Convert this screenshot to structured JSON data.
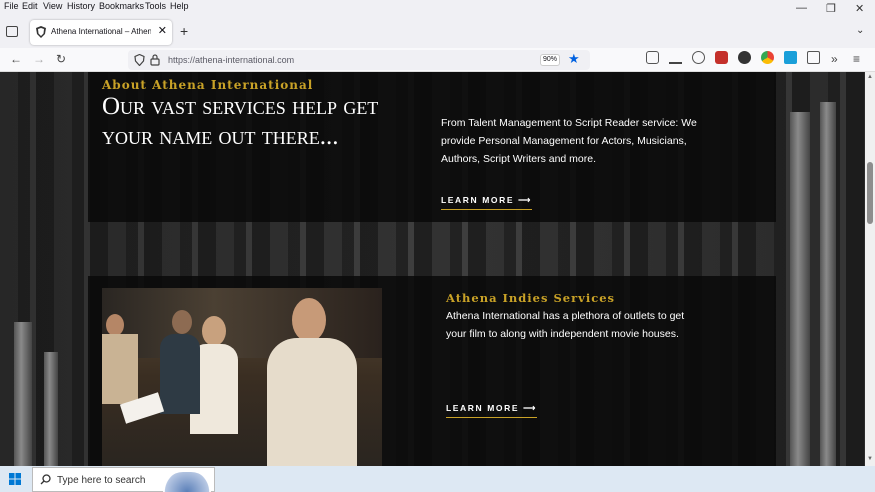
{
  "menu": [
    "File",
    "Edit",
    "View",
    "History",
    "Bookmarks",
    "Tools",
    "Help"
  ],
  "window_controls": {
    "minimize": "—",
    "restore": "❐",
    "close": "✕"
  },
  "tab": {
    "title": "Athena International – Athena I",
    "close": "✕"
  },
  "new_tab": "+",
  "tab_overflow": "⌄",
  "nav": {
    "back": "←",
    "forward": "→",
    "reload": "↻"
  },
  "url": "https://athena-international.com",
  "zoom": "90%",
  "bookmark_star": "★",
  "toolbar_overflow": "»",
  "menu_icon": "≡",
  "about": {
    "subtitle": "About Athena International",
    "title": "Our vast services help get your name out there...",
    "text": "From Talent Management to Script Reader service: We provide Personal Management for Actors, Musicians, Authors, Script Writers and more.",
    "learn_more": "LEARN MORE  ⟶"
  },
  "indies": {
    "title": "Athena Indies Services",
    "text": "Athena International has a plethora of outlets to get your film to along with independent movie houses.",
    "learn_more": "LEARN MORE  ⟶"
  },
  "taskbar": {
    "search_placeholder": "Type here to search"
  },
  "colors": {
    "accent_gold": "#c9a227",
    "card_bg": "#0a0a0a",
    "star_blue": "#0061e0"
  }
}
